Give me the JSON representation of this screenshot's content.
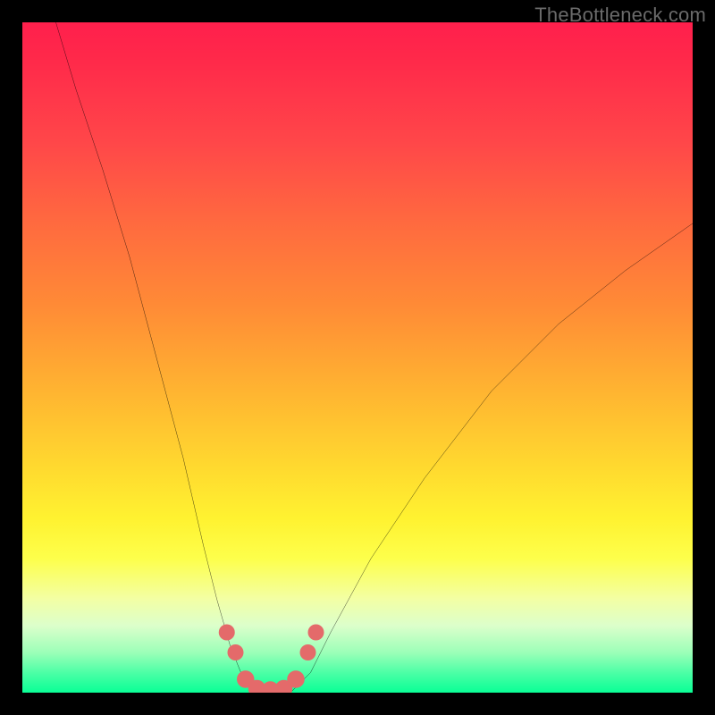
{
  "watermark": "TheBottleneck.com",
  "chart_data": {
    "type": "line",
    "title": "",
    "xlabel": "",
    "ylabel": "",
    "xlim": [
      0,
      100
    ],
    "ylim": [
      0,
      100
    ],
    "background_gradient": {
      "top_color": "#ff1f4c",
      "bottom_color": "#0bff96",
      "stops": [
        "red-pink",
        "orange",
        "yellow",
        "pale-yellow",
        "green"
      ]
    },
    "series": [
      {
        "name": "left_curve",
        "stroke": "#000000",
        "points": [
          {
            "x": 5,
            "y": 100
          },
          {
            "x": 8,
            "y": 90
          },
          {
            "x": 12,
            "y": 78
          },
          {
            "x": 16,
            "y": 65
          },
          {
            "x": 20,
            "y": 50
          },
          {
            "x": 24,
            "y": 35
          },
          {
            "x": 27,
            "y": 22
          },
          {
            "x": 29,
            "y": 14
          },
          {
            "x": 31,
            "y": 7
          },
          {
            "x": 33,
            "y": 2
          },
          {
            "x": 35,
            "y": 0
          }
        ]
      },
      {
        "name": "right_curve",
        "stroke": "#000000",
        "points": [
          {
            "x": 40,
            "y": 0
          },
          {
            "x": 43,
            "y": 3
          },
          {
            "x": 46,
            "y": 9
          },
          {
            "x": 52,
            "y": 20
          },
          {
            "x": 60,
            "y": 32
          },
          {
            "x": 70,
            "y": 45
          },
          {
            "x": 80,
            "y": 55
          },
          {
            "x": 90,
            "y": 63
          },
          {
            "x": 100,
            "y": 70
          }
        ]
      },
      {
        "name": "valley_floor",
        "stroke": "#e46a6a",
        "points": [
          {
            "x": 35,
            "y": 0
          },
          {
            "x": 40,
            "y": 0
          }
        ]
      }
    ],
    "markers": [
      {
        "x": 30.5,
        "y": 9,
        "r": 1.2,
        "color": "#e46a6a"
      },
      {
        "x": 31.8,
        "y": 6,
        "r": 1.2,
        "color": "#e46a6a"
      },
      {
        "x": 33.3,
        "y": 2,
        "r": 1.3,
        "color": "#e46a6a"
      },
      {
        "x": 35.0,
        "y": 0.6,
        "r": 1.3,
        "color": "#e46a6a"
      },
      {
        "x": 37.0,
        "y": 0.4,
        "r": 1.3,
        "color": "#e46a6a"
      },
      {
        "x": 39.0,
        "y": 0.6,
        "r": 1.3,
        "color": "#e46a6a"
      },
      {
        "x": 40.8,
        "y": 2,
        "r": 1.3,
        "color": "#e46a6a"
      },
      {
        "x": 42.6,
        "y": 6,
        "r": 1.2,
        "color": "#e46a6a"
      },
      {
        "x": 43.8,
        "y": 9,
        "r": 1.2,
        "color": "#e46a6a"
      }
    ]
  }
}
